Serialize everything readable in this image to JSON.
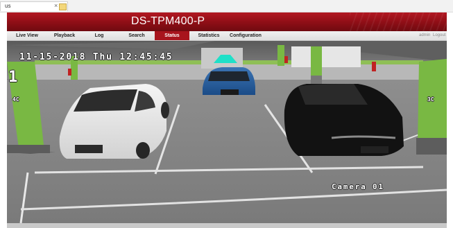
{
  "tab": {
    "title": "us",
    "close": "×"
  },
  "header": {
    "title": "DS-TPM400-P"
  },
  "nav": {
    "items": [
      {
        "label": "Live View"
      },
      {
        "label": "Playback"
      },
      {
        "label": "Log"
      },
      {
        "label": "Search"
      },
      {
        "label": "Status",
        "active": true
      },
      {
        "label": "Statistics"
      },
      {
        "label": "Configuration"
      }
    ],
    "user": "admin",
    "logout": "Logout"
  },
  "video": {
    "timestamp": "11-15-2018 Thu 12:45:45",
    "camera_label": "Camera 01",
    "pillar_labels": [
      "1",
      "4C",
      "3C"
    ]
  },
  "colors": {
    "header_red": "#9b111b",
    "active_tab": "#a8141d",
    "pillar_green": "#79b843",
    "floor_gray": "#8a8a8a"
  }
}
